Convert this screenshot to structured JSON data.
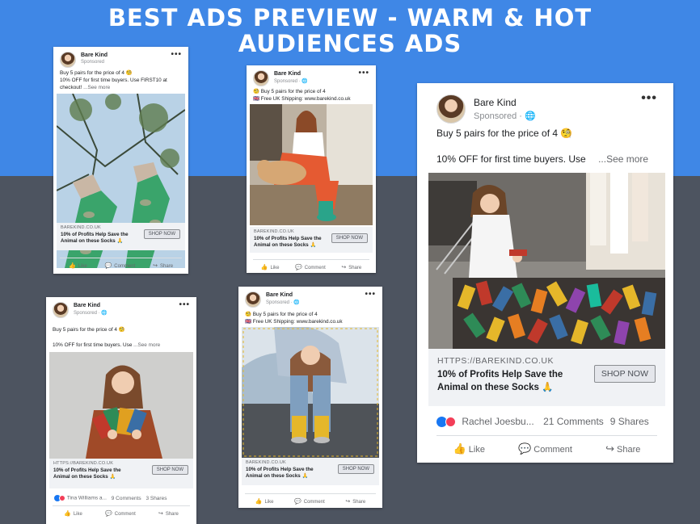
{
  "headline": {
    "line1": "BEST ADS PREVIEW - WARM & HOT",
    "line2": "AUDIENCES ADS"
  },
  "common": {
    "brand": "Bare Kind",
    "sponsored": "Sponsored",
    "sponsored_globe": "Sponsored · 🌐",
    "see_more": "...See more",
    "shop_now": "SHOP NOW",
    "like": "Like",
    "comment": "Comment",
    "share": "Share",
    "link_headline": "10% of Profits Help Save the Animal on these Socks 🙏"
  },
  "ads": [
    {
      "copy_1": "Buy 5 pairs for the price of 4 🧐",
      "copy_2": "10% OFF for first time buyers. Use FIRST10 at checkout!",
      "domain": "BAREKIND.CO.UK"
    },
    {
      "copy_1": "🧐 Buy 5 pairs for the price of 4",
      "copy_2": "🇬🇧 Free UK Shipping: www.barekind.co.uk",
      "domain": "BAREKIND.CO.UK"
    },
    {
      "copy_1": "Buy 5 pairs for the price of 4 🧐",
      "copy_2": "10% OFF for first time buyers. Use",
      "domain": "HTTPS://BAREKIND.CO.UK",
      "reactor": "Tina Williams a...",
      "comments": "9 Comments",
      "shares": "3 Shares"
    },
    {
      "copy_1": "🧐 Buy 5 pairs for the price of 4",
      "copy_2": "🇬🇧 Free UK Shipping: www.barekind.co.uk",
      "domain": "BAREKIND.CO.UK"
    },
    {
      "copy_1": "Buy 5 pairs for the price of 4 🧐",
      "copy_2": "10% OFF for first time buyers. Use",
      "domain": "HTTPS://BAREKIND.CO.UK",
      "reactor": "Rachel Joesbu...",
      "comments": "21 Comments",
      "shares": "9 Shares"
    }
  ],
  "colors": {
    "top_band": "#3f87e6",
    "bottom_band": "#4d5460",
    "like_blue": "#1877f2",
    "love_red": "#f33e58"
  }
}
